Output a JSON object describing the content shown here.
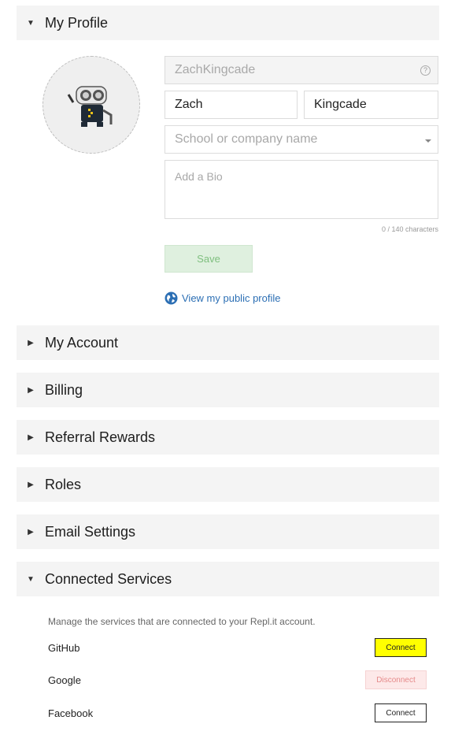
{
  "profile": {
    "section_title": "My Profile",
    "username": "ZachKingcade",
    "help_glyph": "?",
    "first_name": "Zach",
    "last_name": "Kingcade",
    "school_placeholder": "School or company name",
    "bio_placeholder": "Add a Bio",
    "char_count": "0 / 140 characters",
    "save_label": "Save",
    "public_profile_link": "View my public profile"
  },
  "sections": [
    {
      "title": "My Account"
    },
    {
      "title": "Billing"
    },
    {
      "title": "Referral Rewards"
    },
    {
      "title": "Roles"
    },
    {
      "title": "Email Settings"
    }
  ],
  "connected_services": {
    "section_title": "Connected Services",
    "description": "Manage the services that are connected to your Repl.it account.",
    "services": [
      {
        "name": "GitHub",
        "action": "Connect"
      },
      {
        "name": "Google",
        "action": "Disconnect"
      },
      {
        "name": "Facebook",
        "action": "Connect"
      }
    ]
  },
  "colors": {
    "header_bg": "#f4f4f4",
    "link_blue": "#2c6fb4",
    "save_green": "#dff0df",
    "highlight_yellow": "#ffff00",
    "disconnect_red": "#fde9e9"
  }
}
